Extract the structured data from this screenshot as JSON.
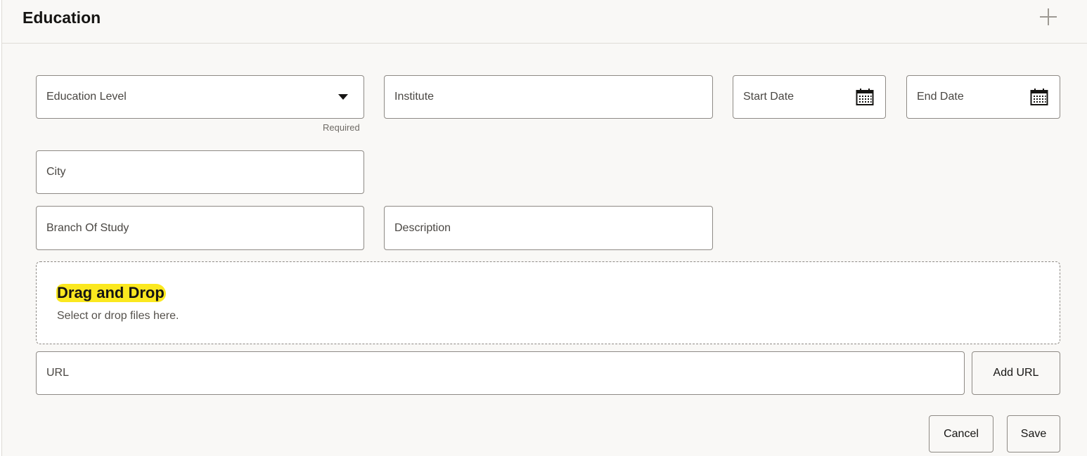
{
  "section": {
    "title": "Education",
    "add_icon": "plus-icon"
  },
  "form": {
    "education_level": {
      "label": "Education Level",
      "helper": "Required",
      "icon": "caret-down-icon"
    },
    "institute": {
      "label": "Institute"
    },
    "start_date": {
      "label": "Start Date",
      "icon": "calendar-icon"
    },
    "end_date": {
      "label": "End Date",
      "icon": "calendar-icon"
    },
    "city": {
      "label": "City"
    },
    "branch_of_study": {
      "label": "Branch Of Study"
    },
    "description": {
      "label": "Description"
    }
  },
  "dropzone": {
    "title": "Drag and Drop",
    "subtitle": "Select or drop files here.",
    "highlight_color": "#fbe81f"
  },
  "url": {
    "label": "URL",
    "add_button": "Add URL"
  },
  "actions": {
    "cancel": "Cancel",
    "save": "Save"
  }
}
